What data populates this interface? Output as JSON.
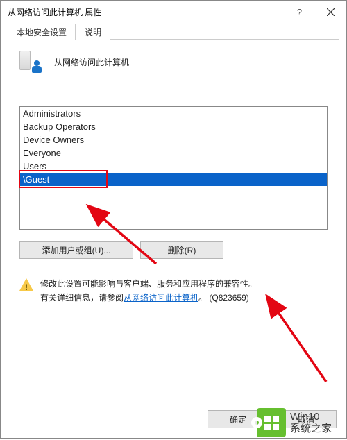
{
  "window": {
    "title": "从网络访问此计算机 属性"
  },
  "tabs": {
    "security": "本地安全设置",
    "explain": "说明"
  },
  "header": {
    "title": "从网络访问此计算机"
  },
  "listbox": {
    "items": [
      "Administrators",
      "Backup Operators",
      "Device Owners",
      "Everyone",
      "Users"
    ],
    "selected": "\\Guest"
  },
  "buttons": {
    "add": "添加用户或组(U)...",
    "remove": "删除(R)",
    "ok": "确定",
    "cancel": "取消"
  },
  "info": {
    "line1": "修改此设置可能影响与客户端、服务和应用程序的兼容性。",
    "line2a": "有关详细信息，请参阅",
    "link": "从网络访问此计算机",
    "line2b": "。 (Q823659)"
  },
  "watermark": {
    "line1": "Win10",
    "line2": "系统之家"
  }
}
